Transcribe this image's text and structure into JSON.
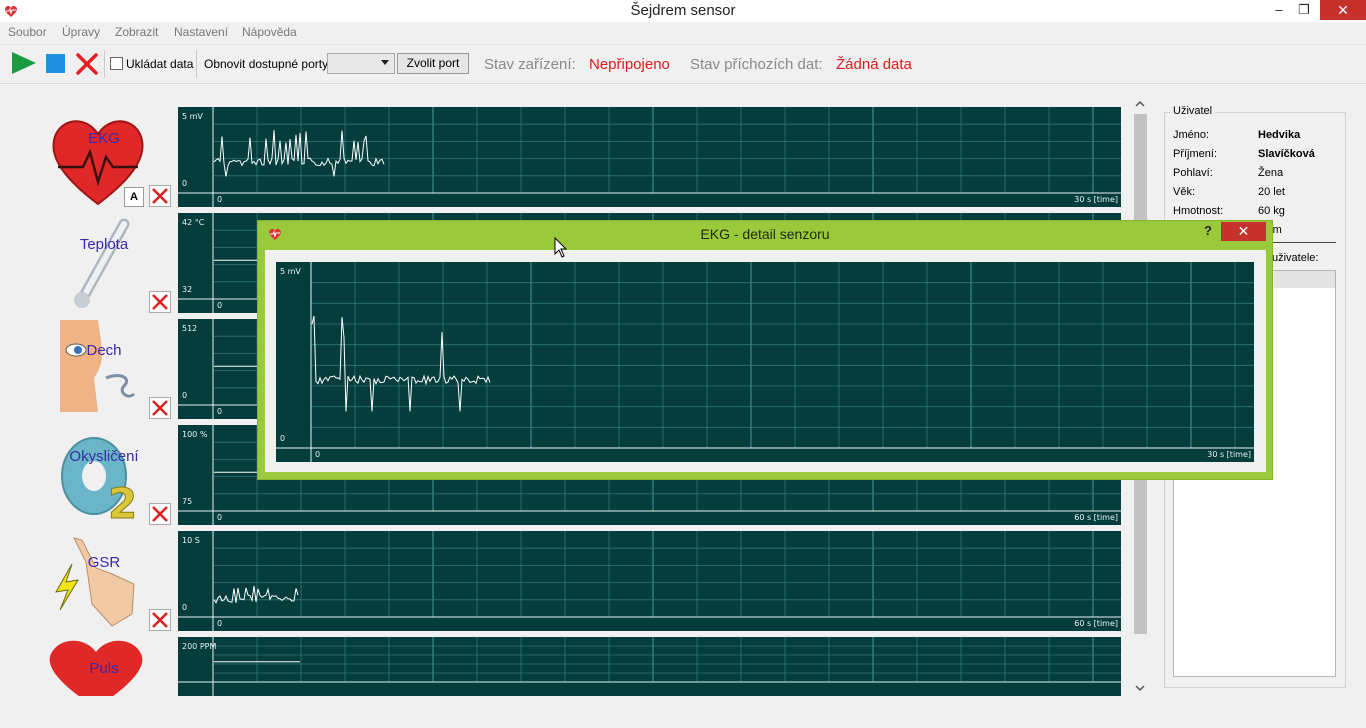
{
  "window": {
    "title": "Šejdrem sensor",
    "minimize": "–",
    "restore": "❐",
    "close": "✕"
  },
  "menu": [
    "Soubor",
    "Úpravy",
    "Zobrazit",
    "Nastavení",
    "Nápověda"
  ],
  "toolbar": {
    "save_data_label": "Ukládat data",
    "refresh_ports_label": "Obnovit dostupné porty",
    "choose_port_label": "Zvolit port",
    "port_value": "",
    "device_status_label": "Stav zařízení:",
    "device_status_value": "Nepřipojeno",
    "data_status_label": "Stav příchozích dat:",
    "data_status_value": "Žádná data",
    "status_color": "#e01b1b"
  },
  "sensors": [
    {
      "name": "EKG",
      "icon": "heart-ekg-icon",
      "badge": "A"
    },
    {
      "name": "Teplota",
      "icon": "thermometer-icon"
    },
    {
      "name": "Dech",
      "icon": "breath-face-icon"
    },
    {
      "name": "Okysličení",
      "icon": "oxygen-o2-icon"
    },
    {
      "name": "GSR",
      "icon": "gsr-hand-icon"
    },
    {
      "name": "Puls",
      "icon": "pulse-heart-icon"
    }
  ],
  "charts": [
    {
      "ymax": "5 mV",
      "ymin": "0",
      "xmin": "0",
      "xmax": "30 s [time]"
    },
    {
      "ymax": "42 °C",
      "ymin": "32",
      "xmin": "0",
      "xmax": ""
    },
    {
      "ymax": "512",
      "ymin": "0",
      "xmin": "0",
      "xmax": ""
    },
    {
      "ymax": "100 %",
      "ymin": "75",
      "xmin": "0",
      "xmax": "60 s [time]"
    },
    {
      "ymax": "10 S",
      "ymin": "0",
      "xmin": "0",
      "xmax": "60 s [time]"
    },
    {
      "ymax": "200 PPM",
      "ymin": "",
      "xmin": "",
      "xmax": ""
    }
  ],
  "user": {
    "group_title": "Uživatel",
    "fields": [
      {
        "key": "Jméno:",
        "value": "Hedvika",
        "bold": true
      },
      {
        "key": "Příjmení:",
        "value": "Slavíčková",
        "bold": true
      },
      {
        "key": "Pohlaví:",
        "value": "Žena",
        "bold": false
      },
      {
        "key": "Věk:",
        "value": "20 let",
        "bold": false
      },
      {
        "key": "Hmotnost:",
        "value": "60 kg",
        "bold": false
      },
      {
        "key": "",
        "value": "0 cm",
        "bold": false
      }
    ],
    "list_caption": "uživatele:"
  },
  "dialog": {
    "title": "EKG - detail senzoru",
    "help": "?",
    "close": "✕",
    "ymax": "5 mV",
    "ymin": "0",
    "xmin": "0",
    "xmax": "30 s [time]"
  },
  "colors": {
    "chart_bg": "#053c3c",
    "grid": "#2f7777",
    "trace": "#ffffff",
    "dialog_frame": "#9ac93c"
  }
}
